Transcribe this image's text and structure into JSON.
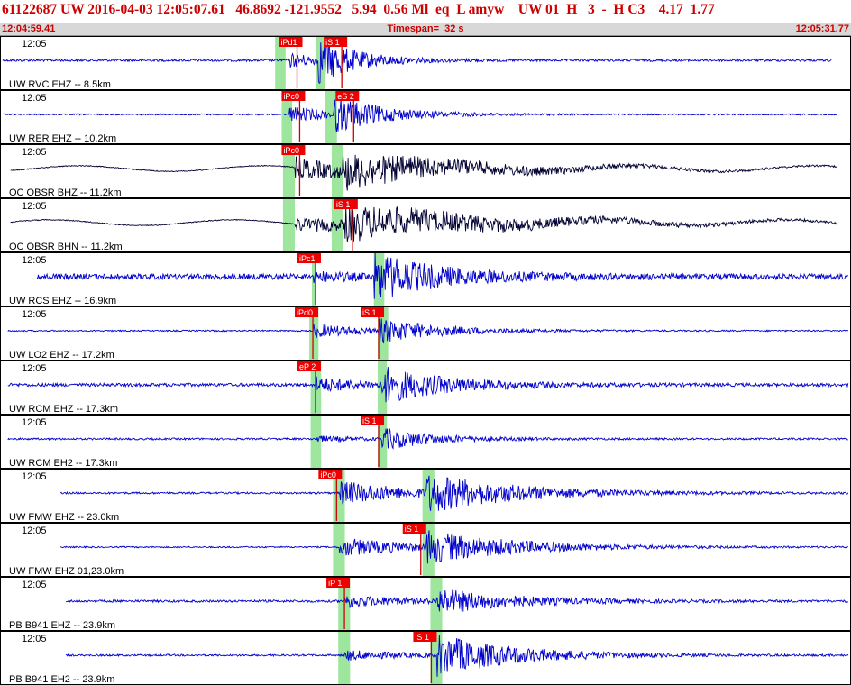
{
  "header": {
    "title": "61122687 UW 2016-04-03 12:05:07.61   46.8692 -121.9552   5.94  0.56 Ml  eq  L amyw    UW 01  H   3  -  H C3    4.17  1.77",
    "start_time": "12:04:59.41",
    "timespan": "Timespan=  32 s",
    "end_time": "12:05:31.77"
  },
  "colors": {
    "trace_blue": "#0000cc",
    "trace_black": "#000033",
    "pick_flag": "#ee0000",
    "pick_line": "#cc0000",
    "window_green": "#9ee69e",
    "header_text": "#cc0000",
    "border": "#000000"
  },
  "chart_data": {
    "type": "seismogram",
    "time_range": [
      0,
      32.36
    ],
    "time_units": "seconds after 12:04:59.41",
    "minute_label": "12:05",
    "traces": [
      {
        "label": "UW RVC EHZ -- 8.5km",
        "color": "blue",
        "start": 0,
        "end": 31.6,
        "p_arrival": 11.0,
        "s_arrival": 12.1,
        "noise": 0.05,
        "p_amp": 0.3,
        "s_amp": 0.9,
        "coda": 1.5,
        "lowfreq": 0.0,
        "picks": [
          {
            "label": "iPd1",
            "t": 10.6
          },
          {
            "label": "iS 1",
            "t": 12.3
          }
        ],
        "windows": [
          [
            10.45,
            10.85
          ],
          [
            12.0,
            12.35
          ]
        ]
      },
      {
        "label": "UW RER EHZ -- 10.2km",
        "color": "blue",
        "start": 0.1,
        "end": 31.8,
        "p_arrival": 11.0,
        "s_arrival": 12.7,
        "noise": 0.03,
        "p_amp": 0.35,
        "s_amp": 0.7,
        "coda": 2.0,
        "lowfreq": 0.0,
        "picks": [
          {
            "label": "iPc0",
            "t": 10.7
          },
          {
            "label": "eS 2",
            "t": 12.75
          }
        ],
        "windows": [
          [
            10.7,
            11.1
          ],
          [
            12.35,
            12.8
          ]
        ]
      },
      {
        "label": "OC OBSR BHZ -- 11.2km",
        "color": "black",
        "start": 0.4,
        "end": 31.8,
        "p_arrival": 11.2,
        "s_arrival": 13.0,
        "noise": 0.02,
        "p_amp": 0.45,
        "s_amp": 0.55,
        "coda": 5.0,
        "lowfreq": 0.12,
        "picks": [
          {
            "label": "iPc0",
            "t": 10.7
          }
        ],
        "windows": [
          [
            10.75,
            11.2
          ],
          [
            12.6,
            13.05
          ]
        ]
      },
      {
        "label": "OC OBSR BHN -- 11.2km",
        "color": "black",
        "start": 0.4,
        "end": 31.8,
        "p_arrival": 11.2,
        "s_arrival": 13.1,
        "noise": 0.02,
        "p_amp": 0.3,
        "s_amp": 0.6,
        "coda": 6.0,
        "lowfreq": 0.12,
        "picks": [
          {
            "label": "iS 1",
            "t": 12.7
          }
        ],
        "windows": [
          [
            10.75,
            11.2
          ],
          [
            12.6,
            13.05
          ]
        ]
      },
      {
        "label": "UW RCS EHZ -- 16.9km",
        "color": "blue",
        "start": 1.4,
        "end": 32.7,
        "p_arrival": 11.9,
        "s_arrival": 14.2,
        "noise": 0.12,
        "p_amp": 0.15,
        "s_amp": 0.95,
        "coda": 2.5,
        "lowfreq": 0.0,
        "picks": [
          {
            "label": "iPc1",
            "t": 11.3
          }
        ],
        "windows": [
          [
            11.85,
            12.0
          ],
          [
            14.2,
            14.6
          ]
        ]
      },
      {
        "label": "UW LO2 EHZ -- 17.2km",
        "color": "blue",
        "start": 0.3,
        "end": 32.7,
        "p_arrival": 11.9,
        "s_arrival": 14.4,
        "noise": 0.03,
        "p_amp": 0.3,
        "s_amp": 0.45,
        "coda": 2.5,
        "lowfreq": 0.0,
        "picks": [
          {
            "label": "iPd0",
            "t": 11.2
          },
          {
            "label": "iS 1",
            "t": 13.7
          }
        ],
        "windows": [
          [
            11.75,
            12.1
          ],
          [
            14.35,
            14.75
          ]
        ]
      },
      {
        "label": "UW RCM EHZ -- 17.3km",
        "color": "blue",
        "start": 0.3,
        "end": 32.7,
        "p_arrival": 12.0,
        "s_arrival": 14.5,
        "noise": 0.07,
        "p_amp": 0.3,
        "s_amp": 0.7,
        "coda": 2.5,
        "lowfreq": 0.0,
        "picks": [
          {
            "label": "eP 2",
            "t": 11.3
          }
        ],
        "windows": [
          [
            11.8,
            12.2
          ],
          [
            14.35,
            14.7
          ]
        ]
      },
      {
        "label": "UW RCM EH2 -- 17.3km",
        "color": "blue",
        "start": 0.3,
        "end": 32.7,
        "p_arrival": 12.0,
        "s_arrival": 14.5,
        "noise": 0.04,
        "p_amp": 0.12,
        "s_amp": 0.45,
        "coda": 2.0,
        "lowfreq": 0.0,
        "picks": [
          {
            "label": "iS 1",
            "t": 13.7
          }
        ],
        "windows": [
          [
            11.8,
            12.2
          ],
          [
            14.35,
            14.7
          ]
        ]
      },
      {
        "label": "UW FMW EHZ -- 23.0km",
        "color": "blue",
        "start": 2.3,
        "end": 33.5,
        "p_arrival": 12.9,
        "s_arrival": 16.2,
        "noise": 0.04,
        "p_amp": 0.5,
        "s_amp": 0.7,
        "coda": 3.5,
        "lowfreq": 0.0,
        "picks": [
          {
            "label": "iPc0",
            "t": 12.1
          }
        ],
        "windows": [
          [
            12.65,
            13.1
          ],
          [
            16.05,
            16.5
          ]
        ]
      },
      {
        "label": "UW FMW EHZ 01,23.0km",
        "color": "blue",
        "start": 2.3,
        "end": 33.5,
        "p_arrival": 12.9,
        "s_arrival": 16.2,
        "noise": 0.03,
        "p_amp": 0.4,
        "s_amp": 0.6,
        "coda": 3.5,
        "lowfreq": 0.0,
        "picks": [
          {
            "label": "iS 1",
            "t": 15.3
          }
        ],
        "windows": [
          [
            12.65,
            13.1
          ],
          [
            16.05,
            16.5
          ]
        ]
      },
      {
        "label": "PB B941 EHZ -- 23.9km",
        "color": "blue",
        "start": 2.5,
        "end": 33.5,
        "p_arrival": 13.1,
        "s_arrival": 16.6,
        "noise": 0.05,
        "p_amp": 0.25,
        "s_amp": 0.5,
        "coda": 3.0,
        "lowfreq": 0.0,
        "picks": [
          {
            "label": "iP 1",
            "t": 12.4
          }
        ],
        "windows": [
          [
            12.85,
            13.3
          ],
          [
            16.35,
            16.8
          ]
        ]
      },
      {
        "label": "PB B941 EH2 -- 23.9km",
        "color": "blue",
        "start": 2.5,
        "end": 33.5,
        "p_arrival": 13.1,
        "s_arrival": 16.6,
        "noise": 0.04,
        "p_amp": 0.2,
        "s_amp": 0.85,
        "coda": 3.0,
        "lowfreq": 0.0,
        "picks": [
          {
            "label": "iS 1",
            "t": 15.7
          }
        ],
        "windows": [
          [
            12.85,
            13.3
          ],
          [
            16.35,
            16.8
          ]
        ]
      }
    ]
  }
}
